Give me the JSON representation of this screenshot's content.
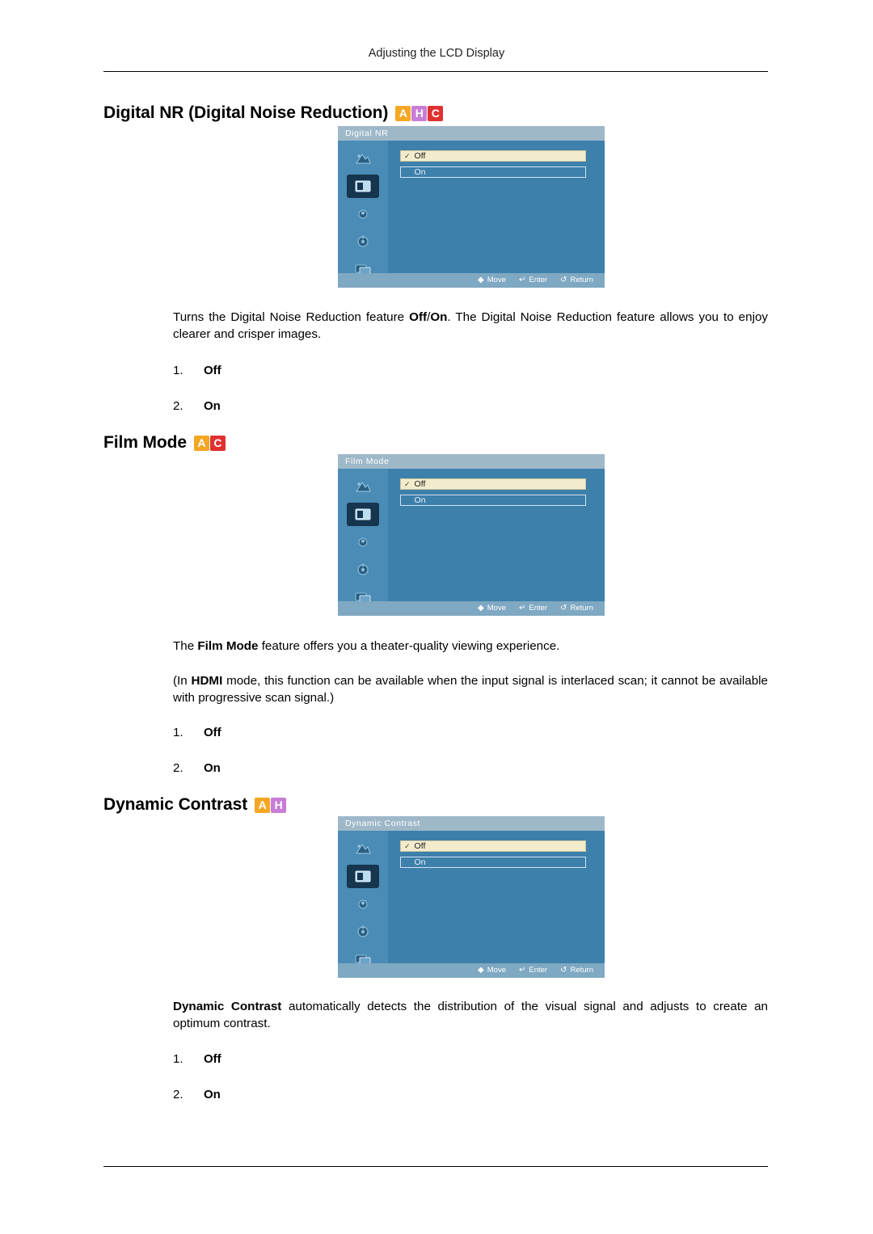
{
  "header": {
    "running_head": "Adjusting the LCD Display"
  },
  "sections": [
    {
      "id": "digital-nr",
      "title": "Digital NR (Digital Noise Reduction)",
      "badges": [
        "A",
        "H",
        "C"
      ],
      "osd": {
        "title": "Digital NR",
        "option_off": "Off",
        "option_on": "On",
        "footer": {
          "move": "Move",
          "enter": "Enter",
          "return": "Return"
        }
      },
      "paragraphs": [
        {
          "parts": [
            {
              "t": "Turns the Digital Noise Reduction feature "
            },
            {
              "t": "Off",
              "b": true
            },
            {
              "t": "/"
            },
            {
              "t": "On",
              "b": true
            },
            {
              "t": ". The Digital Noise Reduction feature allows you to enjoy clearer and crisper images."
            }
          ]
        }
      ],
      "list": [
        {
          "num": "1.",
          "val": "Off"
        },
        {
          "num": "2.",
          "val": "On"
        }
      ]
    },
    {
      "id": "film-mode",
      "title": "Film Mode",
      "badges": [
        "A",
        "C"
      ],
      "osd": {
        "title": "Film Mode",
        "option_off": "Off",
        "option_on": "On",
        "footer": {
          "move": "Move",
          "enter": "Enter",
          "return": "Return"
        }
      },
      "paragraphs": [
        {
          "parts": [
            {
              "t": "The "
            },
            {
              "t": "Film Mode",
              "b": true
            },
            {
              "t": " feature offers you a theater-quality viewing experience."
            }
          ]
        },
        {
          "parts": [
            {
              "t": "(In "
            },
            {
              "t": "HDMI",
              "b": true
            },
            {
              "t": " mode, this function can be available when the input signal is interlaced scan; it cannot be available with progressive scan signal.)"
            }
          ]
        }
      ],
      "list": [
        {
          "num": "1.",
          "val": "Off"
        },
        {
          "num": "2.",
          "val": "On"
        }
      ]
    },
    {
      "id": "dynamic-contrast",
      "title": "Dynamic Contrast",
      "badges": [
        "A",
        "H"
      ],
      "osd": {
        "title": "Dynamic Contrast",
        "option_off": "Off",
        "option_on": "On",
        "footer": {
          "move": "Move",
          "enter": "Enter",
          "return": "Return"
        }
      },
      "paragraphs": [
        {
          "parts": [
            {
              "t": "Dynamic Contrast",
              "b": true
            },
            {
              "t": " automatically detects the distribution of the visual signal and adjusts to create an optimum contrast."
            }
          ]
        }
      ],
      "list": [
        {
          "num": "1.",
          "val": "Off"
        },
        {
          "num": "2.",
          "val": "On"
        }
      ]
    }
  ],
  "colors": {
    "badge_a": "#f5a623",
    "badge_h": "#c77dd6",
    "badge_c": "#e03030",
    "osd_background": "#3d80ab",
    "osd_highlight": "#f2eccd"
  }
}
